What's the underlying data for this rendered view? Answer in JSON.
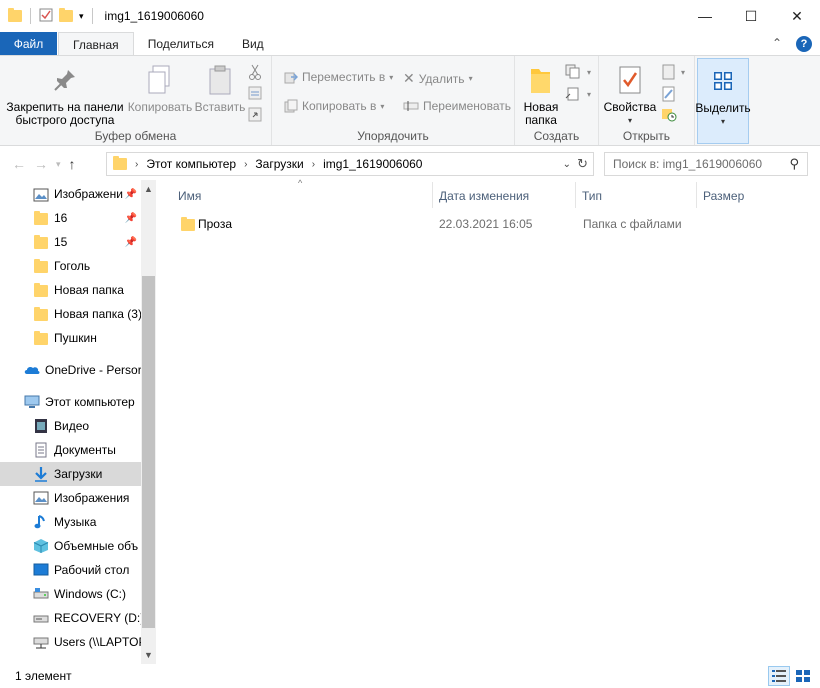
{
  "window": {
    "title": "img1_1619006060",
    "minimize": "—",
    "maximize": "☐",
    "close": "✕"
  },
  "tabs": [
    {
      "label": "Файл"
    },
    {
      "label": "Главная"
    },
    {
      "label": "Поделиться"
    },
    {
      "label": "Вид"
    }
  ],
  "ribbon": {
    "pin_label_line1": "Закрепить на панели",
    "pin_label_line2": "быстрого доступа",
    "copy_label": "Копировать",
    "paste_label": "Вставить",
    "clipboard_group": "Буфер обмена",
    "move_to": "Переместить в",
    "copy_to": "Копировать в",
    "delete": "Удалить",
    "rename": "Переименовать",
    "organize_group": "Упорядочить",
    "new_folder_line1": "Новая",
    "new_folder_line2": "папка",
    "create_group": "Создать",
    "properties": "Свойства",
    "open_group": "Открыть",
    "select": "Выделить"
  },
  "address": {
    "segments": [
      "Этот компьютер",
      "Загрузки",
      "img1_1619006060"
    ],
    "search_placeholder": "Поиск в: img1_1619006060"
  },
  "nav": {
    "items": [
      {
        "label": "Изображени",
        "icon": "pictures-icon",
        "pinned": true
      },
      {
        "label": "16",
        "icon": "folder-icon",
        "pinned": true
      },
      {
        "label": "15",
        "icon": "folder-icon",
        "pinned": true
      },
      {
        "label": "Гоголь",
        "icon": "folder-icon",
        "pinned": false
      },
      {
        "label": "Новая папка",
        "icon": "folder-icon",
        "pinned": false
      },
      {
        "label": "Новая папка (3)",
        "icon": "folder-icon",
        "pinned": false
      },
      {
        "label": "Пушкин",
        "icon": "folder-icon",
        "pinned": false
      },
      {
        "label": "OneDrive - Persor",
        "icon": "cloud-icon",
        "pinned": false
      },
      {
        "label": "Этот компьютер",
        "icon": "computer-icon",
        "pinned": false
      },
      {
        "label": "Видео",
        "icon": "video-icon",
        "pinned": false
      },
      {
        "label": "Документы",
        "icon": "documents-icon",
        "pinned": false
      },
      {
        "label": "Загрузки",
        "icon": "downloads-icon",
        "pinned": false
      },
      {
        "label": "Изображения",
        "icon": "pictures-icon",
        "pinned": false
      },
      {
        "label": "Музыка",
        "icon": "music-icon",
        "pinned": false
      },
      {
        "label": "Объемные объ",
        "icon": "3d-objects-icon",
        "pinned": false
      },
      {
        "label": "Рабочий стол",
        "icon": "desktop-icon",
        "pinned": false
      },
      {
        "label": "Windows (C:)",
        "icon": "drive-icon",
        "pinned": false
      },
      {
        "label": "RECOVERY (D:)",
        "icon": "drive-icon",
        "pinned": false
      },
      {
        "label": "Users (\\\\LAPTOP",
        "icon": "network-drive-icon",
        "pinned": false
      }
    ]
  },
  "columns": {
    "name": "Имя",
    "date": "Дата изменения",
    "type": "Тип",
    "size": "Размер"
  },
  "files": [
    {
      "name": "Проза",
      "date": "22.03.2021 16:05",
      "type": "Папка с файлами",
      "size": ""
    }
  ],
  "status": {
    "count": "1 элемент"
  },
  "colors": {
    "accent": "#1a66b8",
    "folder": "#ffd46a",
    "selected": "#cce8ff"
  }
}
